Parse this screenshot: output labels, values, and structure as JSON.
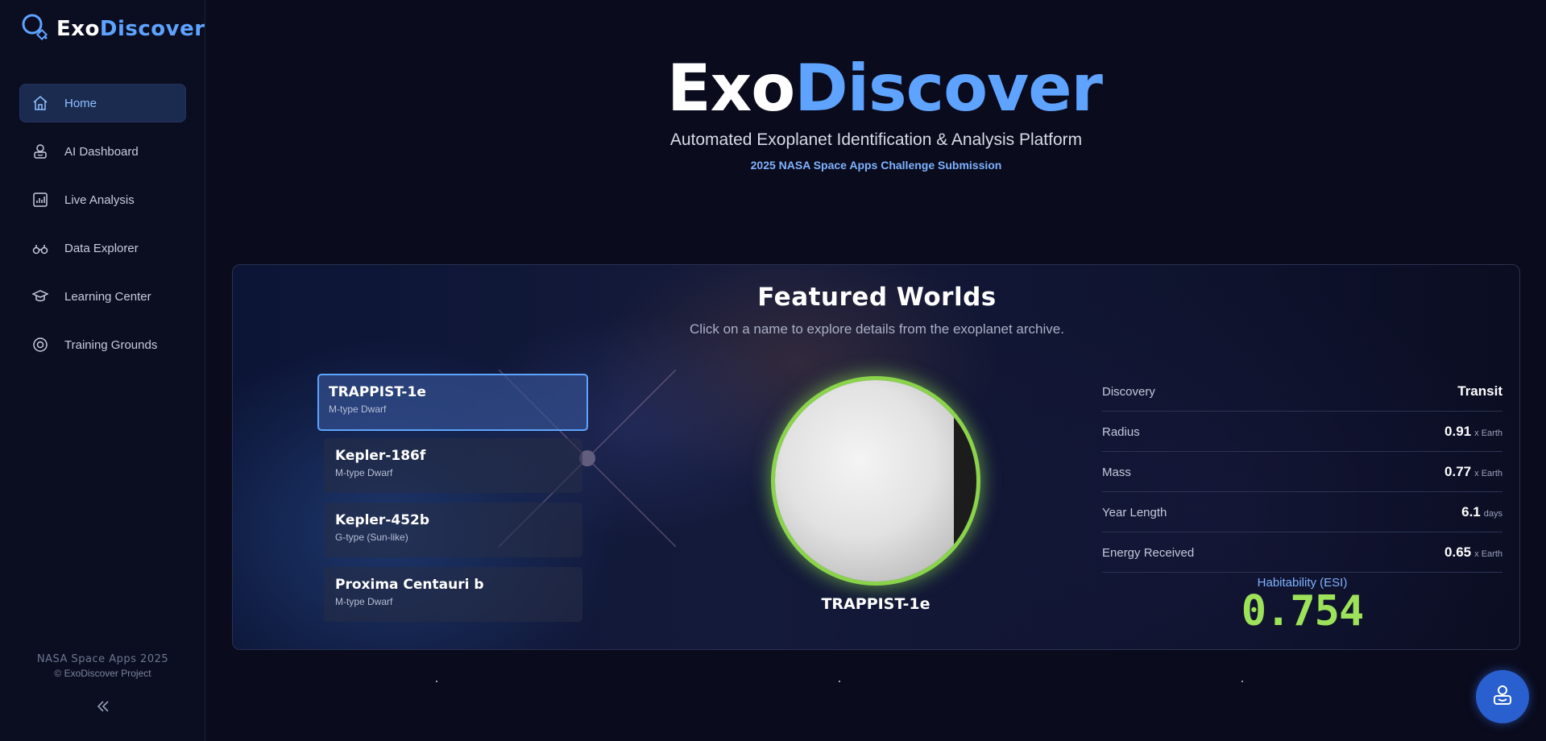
{
  "app": {
    "brand_part1": "Exo",
    "brand_part2": "Discover"
  },
  "sidebar": {
    "items": [
      {
        "label": "Home",
        "icon": "home-icon",
        "active": true
      },
      {
        "label": "AI Dashboard",
        "icon": "robot-icon"
      },
      {
        "label": "Live Analysis",
        "icon": "chart-icon"
      },
      {
        "label": "Data Explorer",
        "icon": "binoculars-icon"
      },
      {
        "label": "Learning Center",
        "icon": "graduation-cap-icon"
      },
      {
        "label": "Training Grounds",
        "icon": "target-icon"
      }
    ],
    "footer_line1": "NASA Space Apps 2025",
    "footer_line2": "© ExoDiscover Project",
    "collapse_icon": "double-chevron-left-icon"
  },
  "hero": {
    "title_part1": "Exo",
    "title_part2": "Discover",
    "subtitle": "Automated Exoplanet Identification & Analysis Platform",
    "tagline": "2025 NASA Space Apps Challenge Submission"
  },
  "featured": {
    "title": "Featured Worlds",
    "subtitle": "Click on a name to explore details from the exoplanet archive.",
    "worlds": [
      {
        "name": "TRAPPIST-1e",
        "type": "M-type Dwarf",
        "selected": true
      },
      {
        "name": "Kepler-186f",
        "type": "M-type Dwarf"
      },
      {
        "name": "Kepler-452b",
        "type": "G-type (Sun-like)"
      },
      {
        "name": "Proxima Centauri b",
        "type": "M-type Dwarf"
      }
    ],
    "selected_planet_name": "TRAPPIST-1e",
    "stats": [
      {
        "label": "Discovery",
        "value": "Transit",
        "unit": ""
      },
      {
        "label": "Radius",
        "value": "0.91",
        "unit": "x Earth"
      },
      {
        "label": "Mass",
        "value": "0.77",
        "unit": "x Earth"
      },
      {
        "label": "Year Length",
        "value": "6.1",
        "unit": "days"
      },
      {
        "label": "Energy Received",
        "value": "0.65",
        "unit": "x Earth"
      }
    ],
    "esi_label": "Habitability (ESI)",
    "esi_value": "0.754"
  },
  "colors": {
    "accent": "#5ea3ff",
    "esi": "#9ee25a",
    "planet_glow": "#8ad34a"
  },
  "fab_icon": "robot-icon"
}
